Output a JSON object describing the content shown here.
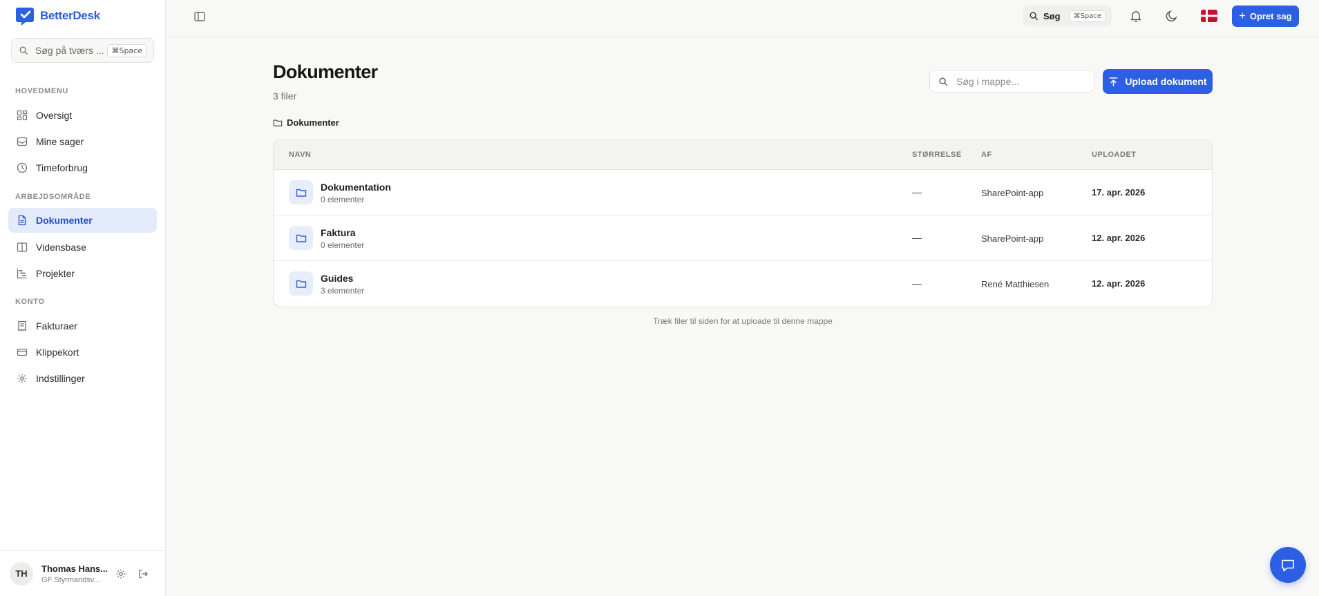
{
  "brand": {
    "name": "BetterDesk",
    "color": "#2d5fd6"
  },
  "sidebar": {
    "search_placeholder": "Søg på tværs ...",
    "search_shortcut": "⌘Space",
    "sections": {
      "main": "HOVEDMENU",
      "workspace": "ARBEJDSOMRÅDE",
      "account": "KONTO"
    },
    "items": [
      {
        "label": "Oversigt",
        "icon": "grid-icon"
      },
      {
        "label": "Mine sager",
        "icon": "inbox-icon"
      },
      {
        "label": "Timeforbrug",
        "icon": "clock-icon"
      },
      {
        "label": "Dokumenter",
        "icon": "document-icon",
        "active": true
      },
      {
        "label": "Vidensbase",
        "icon": "book-icon"
      },
      {
        "label": "Projekter",
        "icon": "gantt-icon"
      },
      {
        "label": "Fakturaer",
        "icon": "receipt-icon"
      },
      {
        "label": "Klippekort",
        "icon": "card-icon"
      },
      {
        "label": "Indstillinger",
        "icon": "gear-icon"
      }
    ],
    "user": {
      "initials": "TH",
      "name": "Thomas Hans...",
      "org": "GF Styrmandsv..."
    }
  },
  "topbar": {
    "search_label": "Søg",
    "search_shortcut": "⌘Space",
    "create_label": "Opret sag",
    "accent": "#2d5fe4"
  },
  "page": {
    "title": "Dokumenter",
    "subtitle": "3 filer",
    "folder_search_placeholder": "Søg i mappe...",
    "upload_label": "Upload dokument",
    "breadcrumb": "Dokumenter",
    "drop_hint": "Træk filer til siden for at uploade til denne mappe"
  },
  "table": {
    "columns": [
      "NAVN",
      "STØRRELSE",
      "AF",
      "UPLOADET"
    ],
    "rows": [
      {
        "name": "Dokumentation",
        "count": "0 elementer",
        "size": "—",
        "by": "SharePoint-app",
        "date": "17. apr. 2026"
      },
      {
        "name": "Faktura",
        "count": "0 elementer",
        "size": "—",
        "by": "SharePoint-app",
        "date": "12. apr. 2026"
      },
      {
        "name": "Guides",
        "count": "3 elementer",
        "size": "—",
        "by": "René Matthiesen",
        "date": "12. apr. 2026"
      }
    ]
  }
}
